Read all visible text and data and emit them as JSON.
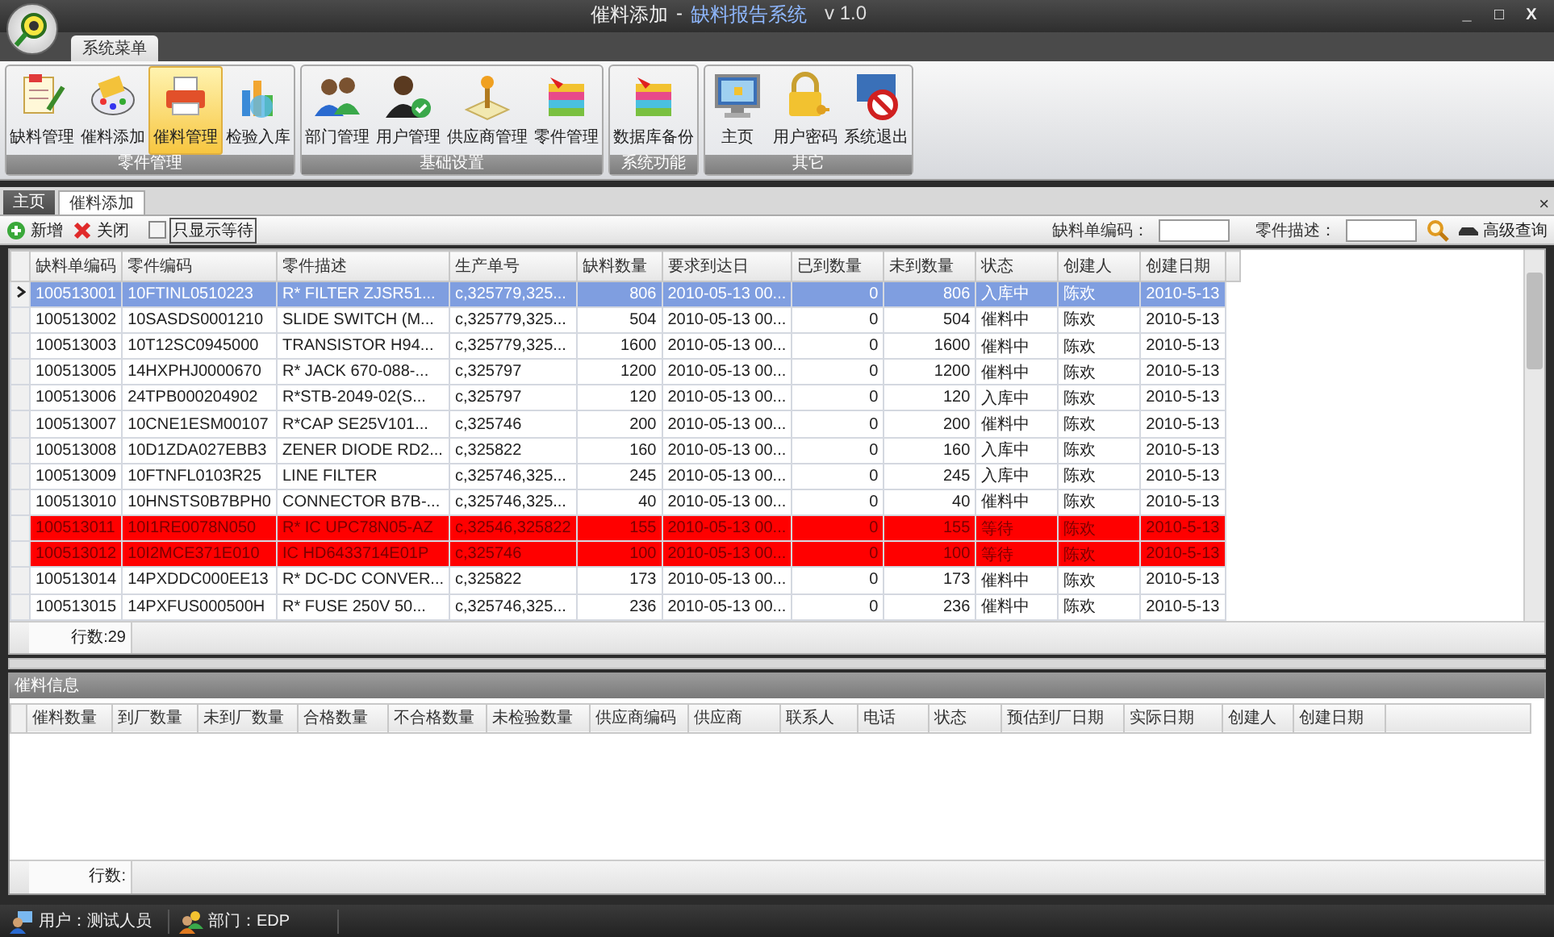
{
  "window": {
    "title_page": "催料添加",
    "title_separator": "-",
    "title_app": "缺料报告系统",
    "version": "v 1.0",
    "controls": [
      "_",
      "□",
      "X"
    ]
  },
  "menu_tab": {
    "label": "系统菜单",
    "selected": true
  },
  "ribbon": [
    {
      "label": "零件管理",
      "buttons": [
        {
          "label": "缺料管理",
          "selected": false
        },
        {
          "label": "催料添加",
          "selected": false
        },
        {
          "label": "催料管理",
          "selected": true
        },
        {
          "label": "检验入库",
          "selected": false
        }
      ]
    },
    {
      "label": "基础设置",
      "buttons": [
        {
          "label": "部门管理",
          "selected": false
        },
        {
          "label": "用户管理",
          "selected": false
        },
        {
          "label": "供应商管理",
          "selected": false
        },
        {
          "label": "零件管理",
          "selected": false
        }
      ]
    },
    {
      "label": "系统功能",
      "buttons": [
        {
          "label": "数据库备份",
          "selected": false
        }
      ]
    },
    {
      "label": "其它",
      "buttons": [
        {
          "label": "主页",
          "selected": false
        },
        {
          "label": "用户密码",
          "selected": false
        },
        {
          "label": "系统退出",
          "selected": false
        }
      ]
    }
  ],
  "doc_tabs": [
    {
      "label": "主页",
      "selected": false
    },
    {
      "label": "催料添加",
      "selected": true
    }
  ],
  "doc_close": "×",
  "toolbar": {
    "add": "新增",
    "close": "关闭",
    "only_waiting": {
      "label": "只显示等待",
      "checked": false
    },
    "filters": [
      {
        "label": "缺料单编码："
      },
      {
        "label": "零件描述："
      }
    ],
    "advanced": "高级查询"
  },
  "table": {
    "columns": [
      {
        "label": "缺料单编码"
      },
      {
        "label": "零件编码"
      },
      {
        "label": "零件描述"
      },
      {
        "label": "生产单号"
      },
      {
        "label": "缺料数量"
      },
      {
        "label": "要求到达日"
      },
      {
        "label": "已到数量"
      },
      {
        "label": "未到数量"
      },
      {
        "label": "状态"
      },
      {
        "label": "创建人"
      },
      {
        "label": "创建日期"
      }
    ],
    "rows": [
      {
        "selected": true,
        "highlighted": false,
        "cells": [
          "100513001",
          "10FTINL0510223",
          "R* FILTER ZJSR51...",
          "c,325779,325...",
          "806",
          "2010-05-13 00...",
          "0",
          "806",
          "入库中",
          "陈欢",
          "2010-5-13"
        ]
      },
      {
        "selected": false,
        "highlighted": false,
        "cells": [
          "100513002",
          "10SASDS0001210",
          "SLIDE SWITCH (M...",
          "c,325779,325...",
          "504",
          "2010-05-13 00...",
          "0",
          "504",
          "催料中",
          "陈欢",
          "2010-5-13"
        ]
      },
      {
        "selected": false,
        "highlighted": false,
        "cells": [
          "100513003",
          "10T12SC0945000",
          "TRANSISTOR H94...",
          "c,325779,325...",
          "1600",
          "2010-05-13 00...",
          "0",
          "1600",
          "催料中",
          "陈欢",
          "2010-5-13"
        ]
      },
      {
        "selected": false,
        "highlighted": false,
        "cells": [
          "100513005",
          "14HXPHJ0000670",
          "R* JACK 670-088-...",
          "c,325797",
          "1200",
          "2010-05-13 00...",
          "0",
          "1200",
          "催料中",
          "陈欢",
          "2010-5-13"
        ]
      },
      {
        "selected": false,
        "highlighted": false,
        "cells": [
          "100513006",
          "24TPB000204902",
          "R*STB-2049-02(S...",
          "c,325797",
          "120",
          "2010-05-13 00...",
          "0",
          "120",
          "入库中",
          "陈欢",
          "2010-5-13"
        ]
      },
      {
        "selected": false,
        "highlighted": false,
        "cells": [
          "100513007",
          "10CNE1ESM00107",
          "R*CAP SE25V101...",
          "c,325746",
          "200",
          "2010-05-13 00...",
          "0",
          "200",
          "催料中",
          "陈欢",
          "2010-5-13"
        ]
      },
      {
        "selected": false,
        "highlighted": false,
        "cells": [
          "100513008",
          "10D1ZDA027EBB3",
          "ZENER DIODE RD2...",
          "c,325822",
          "160",
          "2010-05-13 00...",
          "0",
          "160",
          "入库中",
          "陈欢",
          "2010-5-13"
        ]
      },
      {
        "selected": false,
        "highlighted": false,
        "cells": [
          "100513009",
          "10FTNFL0103R25",
          "LINE FILTER",
          "c,325746,325...",
          "245",
          "2010-05-13 00...",
          "0",
          "245",
          "入库中",
          "陈欢",
          "2010-5-13"
        ]
      },
      {
        "selected": false,
        "highlighted": false,
        "cells": [
          "100513010",
          "10HNSTS0B7BPH0",
          "CONNECTOR B7B-...",
          "c,325746,325...",
          "40",
          "2010-05-13 00...",
          "0",
          "40",
          "催料中",
          "陈欢",
          "2010-5-13"
        ]
      },
      {
        "selected": false,
        "highlighted": true,
        "cells": [
          "100513011",
          "10I1RE0078N050",
          "R* IC UPC78N05-AZ",
          "c,32546,325822",
          "155",
          "2010-05-13 00...",
          "0",
          "155",
          "等待",
          "陈欢",
          "2010-5-13"
        ]
      },
      {
        "selected": false,
        "highlighted": true,
        "cells": [
          "100513012",
          "10I2MCE371E010",
          "IC HD6433714E01P",
          "c,325746",
          "100",
          "2010-05-13 00...",
          "0",
          "100",
          "等待",
          "陈欢",
          "2010-5-13"
        ]
      },
      {
        "selected": false,
        "highlighted": false,
        "cells": [
          "100513014",
          "14PXDDC000EE13",
          "R* DC-DC CONVER...",
          "c,325822",
          "173",
          "2010-05-13 00...",
          "0",
          "173",
          "催料中",
          "陈欢",
          "2010-5-13"
        ]
      },
      {
        "selected": false,
        "highlighted": false,
        "cells": [
          "100513015",
          "14PXFUS000500H",
          "R* FUSE 250V 50...",
          "c,325746,325...",
          "236",
          "2010-05-13 00...",
          "0",
          "236",
          "催料中",
          "陈欢",
          "2010-5-13"
        ]
      }
    ],
    "row_count": "行数:29"
  },
  "detail": {
    "title": "催料信息",
    "columns": [
      "催料数量",
      "到厂数量",
      "未到厂数量",
      "合格数量",
      "不合格数量",
      "未检验数量",
      "供应商编码",
      "供应商",
      "联系人",
      "电话",
      "状态",
      "预估到厂日期",
      "实际日期",
      "创建人",
      "创建日期"
    ],
    "row_count": "行数:"
  },
  "status_bar": [
    {
      "label": "用户：测试人员"
    },
    {
      "label": "部门：EDP"
    }
  ]
}
